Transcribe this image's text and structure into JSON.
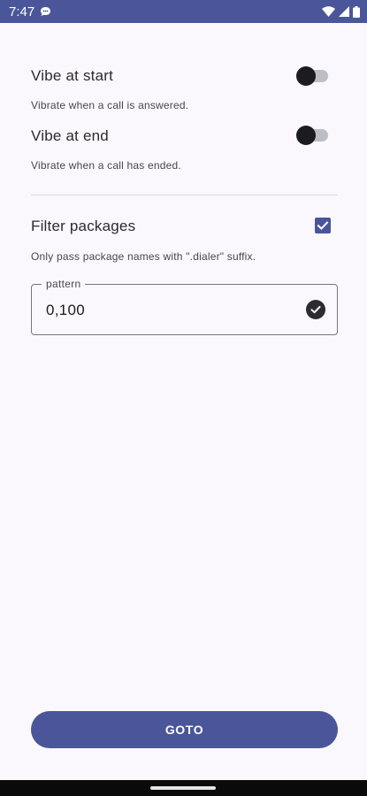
{
  "status_bar": {
    "time": "7:47",
    "icons": [
      "chat-notification-icon",
      "wifi-icon",
      "signal-icon",
      "battery-icon"
    ]
  },
  "settings": {
    "vibe_start": {
      "title": "Vibe at start",
      "subtitle": "Vibrate when a call is answered.",
      "enabled": false
    },
    "vibe_end": {
      "title": "Vibe at end",
      "subtitle": "Vibrate when a call has ended.",
      "enabled": false
    },
    "filter_packages": {
      "title": "Filter packages",
      "subtitle": "Only pass package names with \".dialer\" suffix.",
      "checked": true
    },
    "pattern": {
      "label": "pattern",
      "value": "0,100",
      "icon": "check-circle-icon"
    }
  },
  "actions": {
    "goto_label": "GOTO"
  },
  "colors": {
    "accent": "#4a5699",
    "background": "#fbf8fd",
    "text": "#1c1b1f"
  }
}
